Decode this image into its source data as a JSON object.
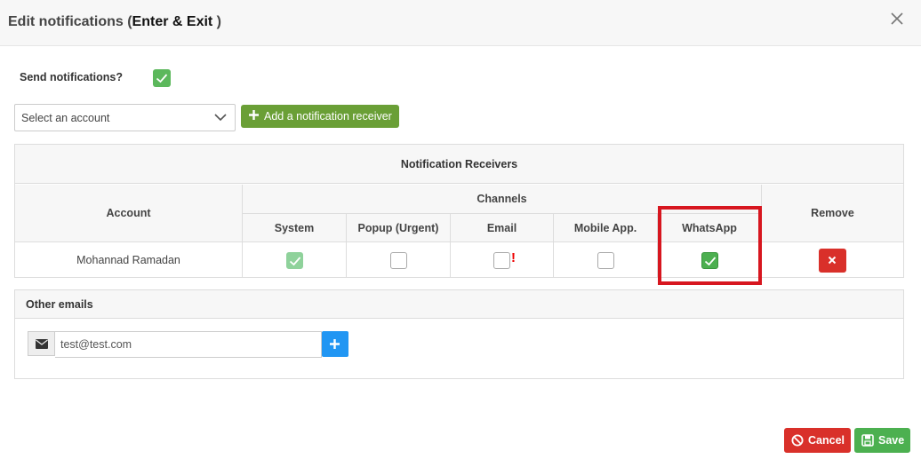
{
  "header": {
    "title_prefix": "Edit notifications (",
    "title_strong": "Enter & Exit",
    "title_suffix": " )"
  },
  "send_notifications": {
    "label": "Send notifications?",
    "checked": true
  },
  "account_select": {
    "value": "Select an account"
  },
  "add_receiver_label": "Add a notification receiver",
  "receivers_panel": {
    "title": "Notification Receivers",
    "account_header": "Account",
    "channels_header": "Channels",
    "remove_header": "Remove",
    "channels": [
      "System",
      "Popup (Urgent)",
      "Email",
      "Mobile App.",
      "WhatsApp"
    ],
    "rows": [
      {
        "account": "Mohannad Ramadan",
        "system": true,
        "popup": false,
        "email": false,
        "email_warning": "!",
        "mobile": false,
        "whatsapp": true
      }
    ]
  },
  "other_emails": {
    "title": "Other emails",
    "input_value": "test@test.com"
  },
  "footer": {
    "cancel_label": "Cancel",
    "save_label": "Save"
  },
  "colors": {
    "accent_green": "#6a9f36",
    "success": "#4cb050",
    "danger": "#d9302a",
    "primary": "#2196f3",
    "highlight": "#d7161f"
  }
}
